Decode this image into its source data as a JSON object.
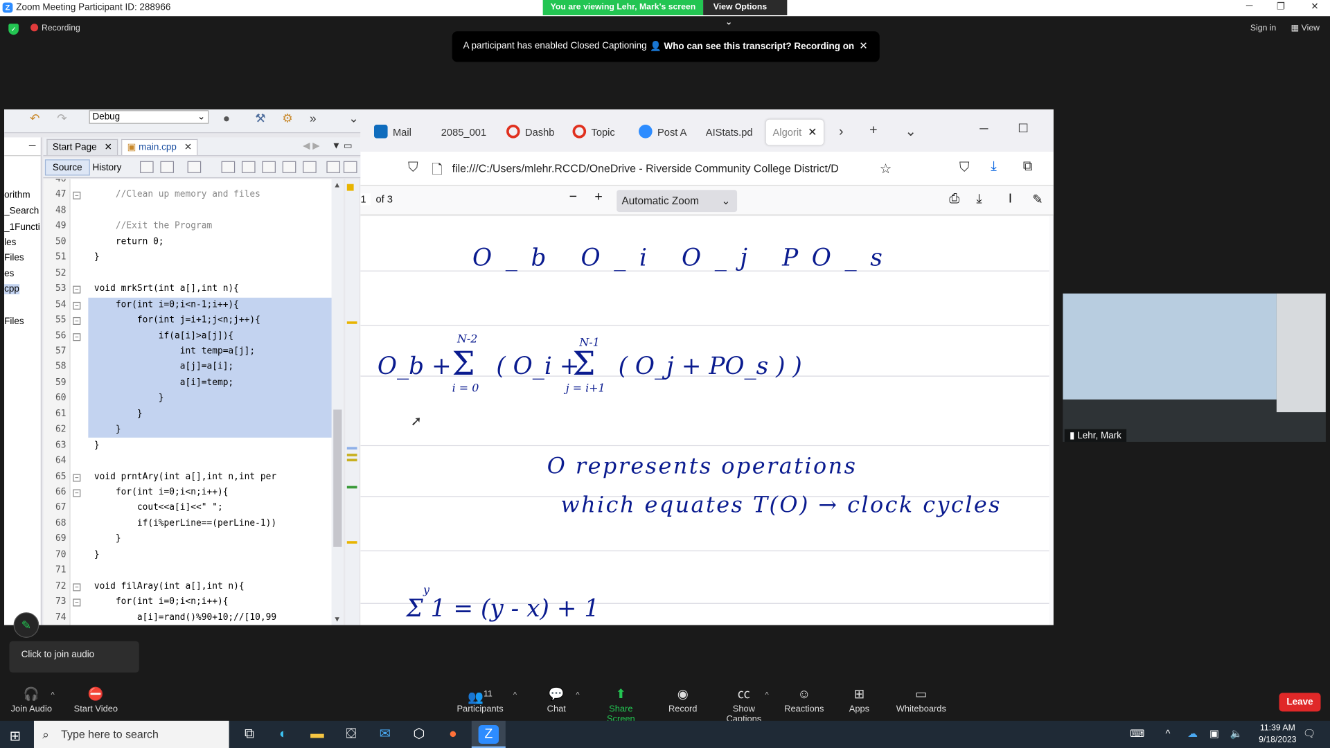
{
  "zoom": {
    "window_title": "Zoom Meeting Participant ID: 288966",
    "viewing_banner": "You are viewing Lehr, Mark's screen",
    "view_options": "View Options",
    "recording_label": "Recording",
    "sign_in": "Sign in",
    "view": "View",
    "cc_message": "A participant has enabled Closed Captioning",
    "cc_who": "Who can see this transcript? Recording on",
    "participant_name": "Lehr, Mark",
    "join_audio_popup": "Click to join audio",
    "controls": {
      "join_audio": "Join Audio",
      "start_video": "Start Video",
      "participants": "Participants",
      "participants_count": "11",
      "chat": "Chat",
      "share_screen": "Share Screen",
      "record": "Record",
      "show_captions": "Show Captions",
      "reactions": "Reactions",
      "apps": "Apps",
      "whiteboards": "Whiteboards",
      "leave": "Leave"
    }
  },
  "ide": {
    "config": "Debug",
    "tabs": [
      "Start Page",
      "main.cpp"
    ],
    "source_tab": "Source",
    "history_tab": "History",
    "left_items": [
      "orithm",
      "_Search",
      "_1Functi",
      "les",
      "Files",
      "es",
      "cpp",
      "Files"
    ],
    "code_lines": [
      {
        "n": "46",
        "t": ""
      },
      {
        "n": "47",
        "t": "    //Clean up memory and files"
      },
      {
        "n": "48",
        "t": ""
      },
      {
        "n": "49",
        "t": "    //Exit the Program"
      },
      {
        "n": "50",
        "t": "    return 0;"
      },
      {
        "n": "51",
        "t": "}"
      },
      {
        "n": "52",
        "t": ""
      },
      {
        "n": "53",
        "t": "void mrkSrt(int a[],int n){"
      },
      {
        "n": "54",
        "t": "    for(int i=0;i<n-1;i++){"
      },
      {
        "n": "55",
        "t": "        for(int j=i+1;j<n;j++){"
      },
      {
        "n": "56",
        "t": "            if(a[i]>a[j]){"
      },
      {
        "n": "57",
        "t": "                int temp=a[j];"
      },
      {
        "n": "58",
        "t": "                a[j]=a[i];"
      },
      {
        "n": "59",
        "t": "                a[i]=temp;"
      },
      {
        "n": "60",
        "t": "            }"
      },
      {
        "n": "61",
        "t": "        }"
      },
      {
        "n": "62",
        "t": "    }"
      },
      {
        "n": "63",
        "t": "}"
      },
      {
        "n": "64",
        "t": ""
      },
      {
        "n": "65",
        "t": "void prntAry(int a[],int n,int per"
      },
      {
        "n": "66",
        "t": "    for(int i=0;i<n;i++){"
      },
      {
        "n": "67",
        "t": "        cout<<a[i]<<\" \";"
      },
      {
        "n": "68",
        "t": "        if(i%perLine==(perLine-1))"
      },
      {
        "n": "69",
        "t": "    }"
      },
      {
        "n": "70",
        "t": "}"
      },
      {
        "n": "71",
        "t": ""
      },
      {
        "n": "72",
        "t": "void filAray(int a[],int n){"
      },
      {
        "n": "73",
        "t": "    for(int i=0;i<n;i++){"
      },
      {
        "n": "74",
        "t": "        a[i]=rand()%90+10;//[10,99"
      }
    ]
  },
  "firefox": {
    "tabs": [
      {
        "label": "Mail",
        "color": "#0f6cbd"
      },
      {
        "label": "2085_001",
        "color": ""
      },
      {
        "label": "Dashb",
        "color": "#e0301e"
      },
      {
        "label": "Topic",
        "color": "#e0301e"
      },
      {
        "label": "Post A",
        "color": "#2d8cff"
      },
      {
        "label": "AIStats.pd",
        "color": ""
      },
      {
        "label": "Algorit",
        "color": ""
      }
    ],
    "url": "file:///C:/Users/mlehr.RCCD/OneDrive - Riverside Community College District/D",
    "page_number": "1",
    "page_of": "of 3",
    "zoom_level": "Automatic Zoom"
  },
  "notes": {
    "line1": "O_b   O_i   O_j   PO_s",
    "line2_prefix": "O_b +",
    "sum1_top": "N-2",
    "sum1_bot": "i = 0",
    "line2_mid": "( O_i +",
    "sum2_top": "N-1",
    "sum2_bot": "j = i+1",
    "line2_suffix": "( O_j + PO_s ) )",
    "line3": "O represents operations",
    "line4": "which equates T(O) → clock cycles",
    "line5": "Σ 1 = (y - x) + 1",
    "sum3_top": "y"
  },
  "taskbar": {
    "search_placeholder": "Type here to search",
    "time": "11:39 AM",
    "date": "9/18/2023"
  },
  "colors": {
    "zoom_green": "#23c552",
    "leave_red": "#e02828",
    "ink_blue": "#0a1b8f",
    "selection": "#c3d3f0"
  }
}
